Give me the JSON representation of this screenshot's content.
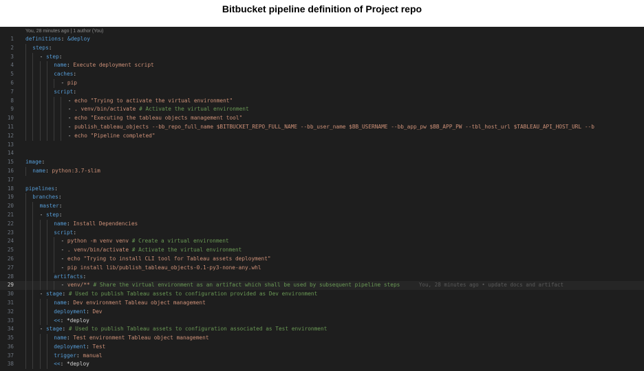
{
  "page_title": "Bitbucket pipeline definition of Project repo",
  "editor": {
    "blame_header": "You, 28 minutes ago | 1 author (You)",
    "current_line": 29,
    "inline_blame": "You, 28 minutes ago • update docs and artifact",
    "colors": {
      "background": "#1e1e1e",
      "key": "#569cd6",
      "string": "#ce9178",
      "comment": "#6a9955",
      "punctuation": "#d4d4d4",
      "line_number": "#6e7681"
    },
    "lines": [
      {
        "n": "1",
        "indent": 0,
        "segs": [
          [
            "k",
            "definitions"
          ],
          [
            "p",
            ": "
          ],
          [
            "k",
            "&deploy"
          ]
        ]
      },
      {
        "n": "2",
        "indent": 1,
        "segs": [
          [
            "k",
            "steps"
          ],
          [
            "p",
            ":"
          ]
        ]
      },
      {
        "n": "3",
        "indent": 2,
        "segs": [
          [
            "p",
            "- "
          ],
          [
            "k",
            "step"
          ],
          [
            "p",
            ":"
          ]
        ]
      },
      {
        "n": "4",
        "indent": 4,
        "segs": [
          [
            "k",
            "name"
          ],
          [
            "p",
            ": "
          ],
          [
            "s",
            "Execute deployment script"
          ]
        ]
      },
      {
        "n": "5",
        "indent": 4,
        "segs": [
          [
            "k",
            "caches"
          ],
          [
            "p",
            ":"
          ]
        ]
      },
      {
        "n": "6",
        "indent": 5,
        "segs": [
          [
            "p",
            "- "
          ],
          [
            "s",
            "pip"
          ]
        ]
      },
      {
        "n": "7",
        "indent": 4,
        "segs": [
          [
            "k",
            "script"
          ],
          [
            "p",
            ":"
          ]
        ]
      },
      {
        "n": "8",
        "indent": 6,
        "segs": [
          [
            "p",
            "- "
          ],
          [
            "s",
            "echo \"Trying to activate the virtual environment\""
          ]
        ]
      },
      {
        "n": "9",
        "indent": 6,
        "segs": [
          [
            "p",
            "- "
          ],
          [
            "s",
            ". venv/bin/activate "
          ],
          [
            "c",
            "# Activate the virtual environment"
          ]
        ]
      },
      {
        "n": "10",
        "indent": 6,
        "segs": [
          [
            "p",
            "- "
          ],
          [
            "s",
            "echo \"Executing the tableau objects management tool\""
          ]
        ]
      },
      {
        "n": "11",
        "indent": 6,
        "segs": [
          [
            "p",
            "- "
          ],
          [
            "s",
            "publish_tableau_objects --bb_repo_full_name $BITBUCKET_REPO_FULL_NAME --bb_user_name $BB_USERNAME --bb_app_pw $BB_APP_PW --tbl_host_url $TABLEAU_API_HOST_URL --b"
          ]
        ]
      },
      {
        "n": "12",
        "indent": 6,
        "segs": [
          [
            "p",
            "- "
          ],
          [
            "s",
            "echo \"Pipeline completed\""
          ]
        ]
      },
      {
        "n": "13",
        "indent": 0,
        "segs": []
      },
      {
        "n": "14",
        "indent": 0,
        "segs": []
      },
      {
        "n": "15",
        "indent": 0,
        "segs": [
          [
            "k",
            "image"
          ],
          [
            "p",
            ":"
          ]
        ]
      },
      {
        "n": "16",
        "indent": 1,
        "segs": [
          [
            "k",
            "name"
          ],
          [
            "p",
            ": "
          ],
          [
            "s",
            "python:3.7-slim"
          ]
        ]
      },
      {
        "n": "17",
        "indent": 0,
        "segs": []
      },
      {
        "n": "18",
        "indent": 0,
        "segs": [
          [
            "k",
            "pipelines"
          ],
          [
            "p",
            ":"
          ]
        ]
      },
      {
        "n": "19",
        "indent": 1,
        "segs": [
          [
            "k",
            "branches"
          ],
          [
            "p",
            ":"
          ]
        ]
      },
      {
        "n": "20",
        "indent": 2,
        "segs": [
          [
            "k",
            "master"
          ],
          [
            "p",
            ":"
          ]
        ]
      },
      {
        "n": "21",
        "indent": 2,
        "segs": [
          [
            "p",
            "- "
          ],
          [
            "k",
            "step"
          ],
          [
            "p",
            ":"
          ]
        ]
      },
      {
        "n": "22",
        "indent": 4,
        "segs": [
          [
            "k",
            "name"
          ],
          [
            "p",
            ": "
          ],
          [
            "s",
            "Install Dependencies"
          ]
        ]
      },
      {
        "n": "23",
        "indent": 4,
        "segs": [
          [
            "k",
            "script"
          ],
          [
            "p",
            ":"
          ]
        ]
      },
      {
        "n": "24",
        "indent": 5,
        "segs": [
          [
            "p",
            "- "
          ],
          [
            "s",
            "python -m venv venv "
          ],
          [
            "c",
            "# Create a virtual environment"
          ]
        ]
      },
      {
        "n": "25",
        "indent": 5,
        "segs": [
          [
            "p",
            "- "
          ],
          [
            "s",
            ". venv/bin/activate "
          ],
          [
            "c",
            "# Activate the virtual environment"
          ]
        ]
      },
      {
        "n": "26",
        "indent": 5,
        "segs": [
          [
            "p",
            "- "
          ],
          [
            "s",
            "echo \"Trying to install CLI tool for Tableau assets deployment\""
          ]
        ]
      },
      {
        "n": "27",
        "indent": 5,
        "segs": [
          [
            "p",
            "- "
          ],
          [
            "s",
            "pip install lib/publish_tableau_objects-0.1-py3-none-any.whl"
          ]
        ]
      },
      {
        "n": "28",
        "indent": 4,
        "segs": [
          [
            "k",
            "artifacts"
          ],
          [
            "p",
            ":"
          ]
        ]
      },
      {
        "n": "29",
        "indent": 5,
        "segs": [
          [
            "p",
            "- "
          ],
          [
            "s",
            "venv/** "
          ],
          [
            "c",
            "# Share the virtual environment as an artifact which shall be used by subsequent pipeline steps"
          ]
        ]
      },
      {
        "n": "30",
        "indent": 2,
        "segs": [
          [
            "p",
            "- "
          ],
          [
            "k",
            "stage"
          ],
          [
            "p",
            ": "
          ],
          [
            "c",
            "# Used to publish Tableau assets to configuration provided as Dev environment"
          ]
        ]
      },
      {
        "n": "31",
        "indent": 4,
        "segs": [
          [
            "k",
            "name"
          ],
          [
            "p",
            ": "
          ],
          [
            "s",
            "Dev environment Tableau object management"
          ]
        ]
      },
      {
        "n": "32",
        "indent": 4,
        "segs": [
          [
            "k",
            "deployment"
          ],
          [
            "p",
            ": "
          ],
          [
            "s",
            "Dev"
          ]
        ]
      },
      {
        "n": "33",
        "indent": 4,
        "segs": [
          [
            "k",
            "<<"
          ],
          [
            "p",
            ": "
          ],
          [
            "p",
            "*deploy"
          ]
        ]
      },
      {
        "n": "34",
        "indent": 2,
        "segs": [
          [
            "p",
            "- "
          ],
          [
            "k",
            "stage"
          ],
          [
            "p",
            ": "
          ],
          [
            "c",
            "# Used to publish Tableau assets to configuration associated as Test environment"
          ]
        ]
      },
      {
        "n": "35",
        "indent": 4,
        "segs": [
          [
            "k",
            "name"
          ],
          [
            "p",
            ": "
          ],
          [
            "s",
            "Test environment Tableau object management"
          ]
        ]
      },
      {
        "n": "36",
        "indent": 4,
        "segs": [
          [
            "k",
            "deployment"
          ],
          [
            "p",
            ": "
          ],
          [
            "s",
            "Test"
          ]
        ]
      },
      {
        "n": "37",
        "indent": 4,
        "segs": [
          [
            "k",
            "trigger"
          ],
          [
            "p",
            ": "
          ],
          [
            "s",
            "manual"
          ]
        ]
      },
      {
        "n": "38",
        "indent": 4,
        "segs": [
          [
            "k",
            "<<"
          ],
          [
            "p",
            ": "
          ],
          [
            "p",
            "*deploy"
          ]
        ]
      }
    ]
  }
}
